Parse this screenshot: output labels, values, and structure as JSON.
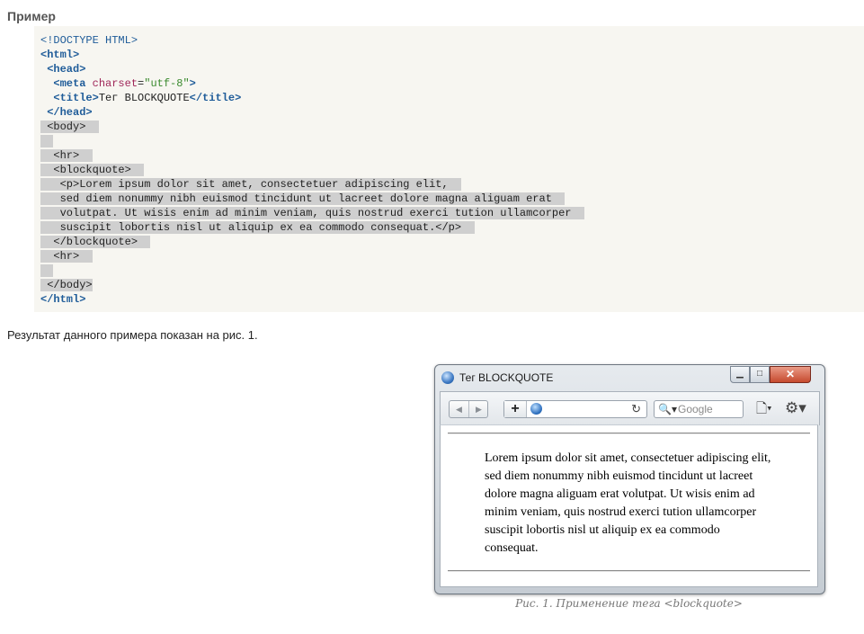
{
  "heading": "Пример",
  "code": {
    "doctype": "<!DOCTYPE HTML>",
    "html_open": "<html>",
    "head_open": "<head>",
    "meta_open": "<meta ",
    "meta_attr": "charset",
    "meta_eq": "=",
    "meta_value": "\"utf-8\"",
    "meta_close": ">",
    "title_open": "<title>",
    "title_text": "Тег BLOCKQUOTE",
    "title_close": "</title>",
    "head_close": "</head>",
    "body_open": "<body>",
    "hr": "<hr>",
    "blockquote_open": "<blockquote>",
    "p_open": "<p>",
    "p_line1": "Lorem ipsum dolor sit amet, consectetuer adipiscing elit,",
    "p_line2": "sed diem nonummy nibh euismod tincidunt ut lacreet dolore magna aliguam erat",
    "p_line3": "volutpat. Ut wisis enim ad minim veniam, quis nostrud exerci tution ullamcorper",
    "p_line4": "suscipit lobortis nisl ut aliquip ex ea commodo consequat.",
    "p_close": "</p>",
    "blockquote_close": "</blockquote>",
    "body_close": "</body>",
    "html_close": "</html>"
  },
  "result_text": "Результат данного примера показан на рис. 1.",
  "browser": {
    "title": "Тег BLOCKQUOTE",
    "min_glyph": "▁",
    "max_glyph": "□",
    "close_glyph": "✕",
    "back_glyph": "◀",
    "forward_glyph": "▶",
    "add_glyph": "+",
    "reload_glyph": "↻",
    "search_glyph": "🔍▾",
    "search_placeholder": "Google",
    "page_menu_glyph": "🗋▾",
    "gear_menu_glyph": "⚙▾",
    "blockquote_text": "Lorem ipsum dolor sit amet, consectetuer adipiscing elit, sed diem nonummy nibh euismod tincidunt ut lacreet dolore magna aliguam erat volutpat. Ut wisis enim ad minim veniam, quis nostrud exerci tution ullamcorper suscipit lobortis nisl ut aliquip ex ea commodo consequat."
  },
  "caption": "Рис. 1. Применение тега <blockquote>"
}
